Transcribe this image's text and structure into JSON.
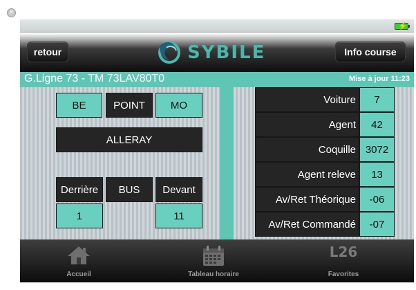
{
  "navbar": {
    "back_label": "retour",
    "info_label": "Info course",
    "logo_text": "SYBILE"
  },
  "ligne": {
    "title": "G.Ligne 73 - TM 73LAV80T0",
    "update": "Mise à jour 11:23"
  },
  "left": {
    "top_buttons": [
      "BE",
      "POINT",
      "MO"
    ],
    "stop_name": "ALLERAY",
    "derriere_label": "Derrière",
    "bus_label": "BUS",
    "devant_label": "Devant",
    "derriere_value": "1",
    "devant_value": "11"
  },
  "right": {
    "rows": [
      {
        "label": "Voiture",
        "value": "7"
      },
      {
        "label": "Agent",
        "value": "42"
      },
      {
        "label": "Coquille",
        "value": "3072"
      },
      {
        "label": "Agent releve",
        "value": "13"
      },
      {
        "label": "Av/Ret Théorique",
        "value": "-06"
      },
      {
        "label": "Av/Ret Commandé",
        "value": "-07"
      }
    ]
  },
  "tabbar": {
    "accueil_label": "Accueil",
    "tableau_label": "Tableau horaire",
    "favorites_icon_text": "L26",
    "favorites_label": "Favorites"
  },
  "icons": {
    "close": "close-icon",
    "battery": "battery-icon",
    "logo": "sybile-logo-icon",
    "home": "home-icon",
    "calendar": "calendar-icon"
  },
  "colors": {
    "accent": "#5fc6b5",
    "cell_teal": "#69cfbf",
    "cell_dark": "#252525"
  }
}
